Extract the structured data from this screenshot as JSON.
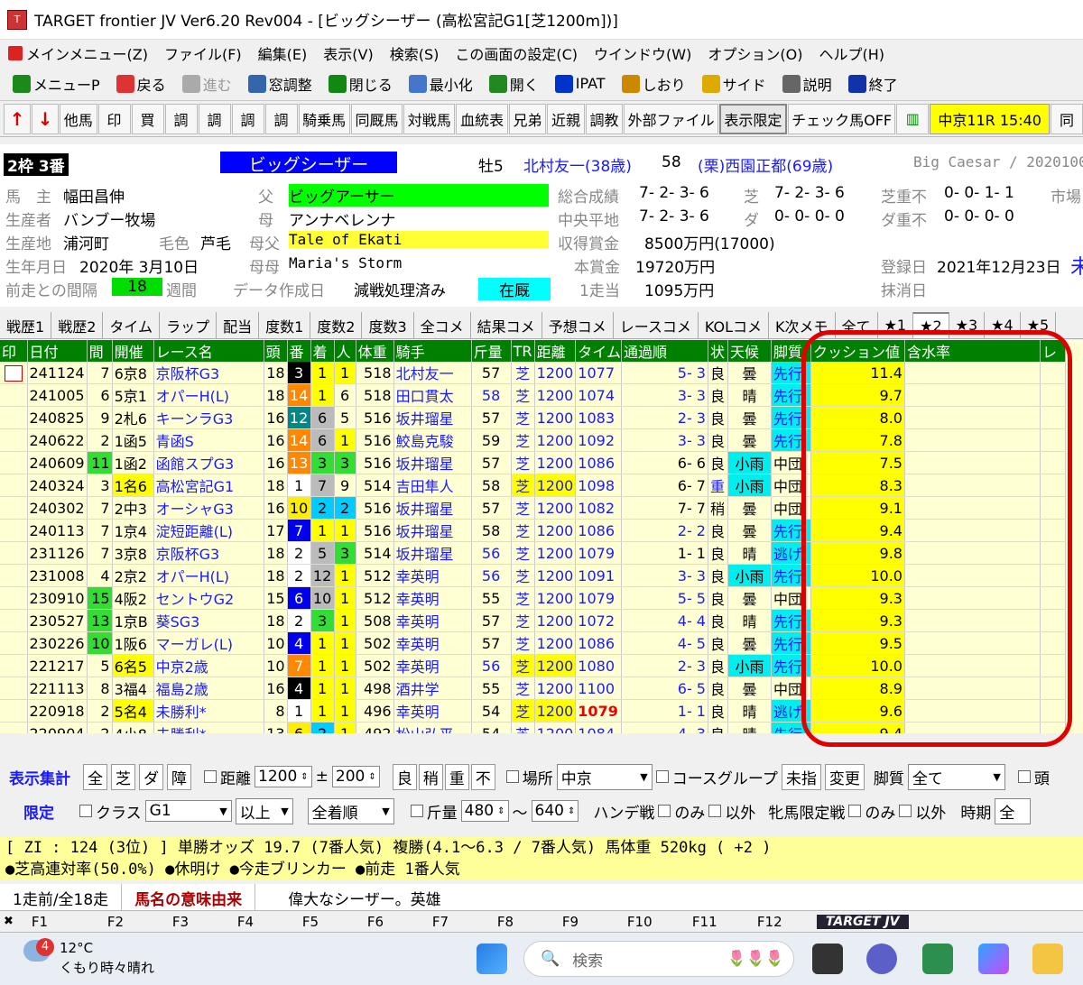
{
  "window": {
    "title": "TARGET frontier JV  Ver6.20  Rev004 - [ビッグシーザー (高松宮記G1[芝1200m])]"
  },
  "menu": [
    "メインメニュー(Z)",
    "ファイル(F)",
    "編集(E)",
    "表示(V)",
    "検索(S)",
    "この画面の設定(C)",
    "ウインドウ(W)",
    "オプション(O)",
    "ヘルプ(H)"
  ],
  "toolbar": [
    "メニューP",
    "戻る",
    "進む",
    "窓調整",
    "閉じる",
    "最小化",
    "開く",
    "IPAT",
    "しおり",
    "サイド",
    "説明",
    "終了"
  ],
  "navbar": [
    "他馬",
    "印",
    "買",
    "調",
    "調",
    "調",
    "調",
    "騎乗馬",
    "同厩馬",
    "対戦馬",
    "血統表",
    "兄弟",
    "近親",
    "調教",
    "外部ファイル",
    "表示限定",
    "チェック馬OFF",
    "同"
  ],
  "race_badge": "中京11R 15:40",
  "horse": {
    "frame": "2枠 3番",
    "name": "ビッグシーザー",
    "sex_age": "牡5",
    "jockey": "北村友一(38歳)",
    "weight": "58",
    "trainer": "(栗)西園正都(69歳)",
    "roman": "Big Caesar / 2020100",
    "owner_lbl": "馬　主",
    "owner": "幅田昌伸",
    "breeder_lbl": "生産者",
    "breeder": "バンブー牧場",
    "origin_lbl": "生産地",
    "origin": "浦河町",
    "color_lbl": "毛色",
    "color": "芦毛",
    "birth_lbl": "生年月日",
    "birth": "2020年 3月10日",
    "gap_lbl": "前走との間隔",
    "gap": "18",
    "gap_unit": "週間",
    "sire_lbl": "父",
    "sire": "ビッグアーサー",
    "dam_lbl": "母",
    "dam": "アンナベレンナ",
    "bms_lbl": "母父",
    "bms": "Tale of Ekati",
    "damdam_lbl": "母母",
    "damdam": "Maria's Storm",
    "data_lbl": "データ作成日",
    "data": "減戦処理済み",
    "status": "在厩",
    "total_lbl": "総合成績",
    "total": "7- 2- 3- 6",
    "turf_lbl": "芝",
    "turf": "7- 2- 3- 6",
    "turf_bad_lbl": "芝重不",
    "turf_bad": "0- 0- 1- 1",
    "market_lbl": "市場",
    "central_lbl": "中央平地",
    "central": "7- 2- 3- 6",
    "dirt_lbl": "ダ",
    "dirt": "0- 0- 0- 0",
    "dirt_bad_lbl": "ダ重不",
    "dirt_bad": "0- 0- 0- 0",
    "earn_lbl": "収得賞金",
    "earn": "8500万円(17000)",
    "prize_lbl": "本賞金",
    "prize": "19720万円",
    "last_lbl": "1走当",
    "last": "1095万円",
    "reg_lbl": "登録日",
    "reg": "2021年12月23日",
    "del_lbl": "抹消日",
    "side": "未"
  },
  "tabs": [
    "戦歴1",
    "戦歴2",
    "タイム",
    "ラップ",
    "配当",
    "度数1",
    "度数2",
    "度数3",
    "全コメ",
    "結果コメ",
    "予想コメ",
    "レースコメ",
    "KOLコメ",
    "K次メモ",
    "全て",
    "★1",
    "★2",
    "★3",
    "★4",
    "★5"
  ],
  "columns": [
    "印",
    "日付",
    "間",
    "開催",
    "レース名",
    "頭",
    "番",
    "着",
    "人",
    "体重",
    "騎手",
    "斤量",
    "TR",
    "距離",
    "タイム",
    "通過順",
    "状",
    "天候",
    "脚質",
    "クッション値",
    "含水率",
    "レ"
  ],
  "rows": [
    {
      "date": "241124",
      "gap": "7",
      "meet": "6京8",
      "race": "京阪杯G3",
      "n": "18",
      "no": "3",
      "pos": "1",
      "pop": "1",
      "wt": "518",
      "jk": "北村友一",
      "kg": "57",
      "tr": "芝",
      "dist": "1200",
      "time": "1077",
      "pass": "5- 3",
      "cond": "良",
      "wx": "曇",
      "style": "先行",
      "cush": "11.4"
    },
    {
      "date": "241005",
      "gap": "6",
      "meet": "5京1",
      "race": "オパーH(L)",
      "n": "18",
      "no": "14",
      "pos": "1",
      "pop": "6",
      "wt": "518",
      "jk": "田口貫太",
      "kg": "58",
      "tr": "芝",
      "dist": "1200",
      "time": "1074",
      "pass": "3- 3",
      "cond": "良",
      "wx": "晴",
      "style": "先行",
      "cush": "9.7"
    },
    {
      "date": "240825",
      "gap": "9",
      "meet": "2札6",
      "race": "キーンラG3",
      "n": "16",
      "no": "12",
      "pos": "6",
      "pop": "5",
      "wt": "516",
      "jk": "坂井瑠星",
      "kg": "57",
      "tr": "芝",
      "dist": "1200",
      "time": "1083",
      "pass": "2- 3",
      "cond": "良",
      "wx": "曇",
      "style": "先行",
      "cush": "8.0"
    },
    {
      "date": "240622",
      "gap": "2",
      "meet": "1函5",
      "race": "青函S",
      "n": "16",
      "no": "14",
      "pos": "6",
      "pop": "1",
      "wt": "516",
      "jk": "鮫島克駿",
      "kg": "59",
      "tr": "芝",
      "dist": "1200",
      "time": "1092",
      "pass": "3- 3",
      "cond": "良",
      "wx": "曇",
      "style": "先行",
      "cush": "7.8"
    },
    {
      "date": "240609",
      "gap": "11",
      "meet": "1函2",
      "race": "函館スプG3",
      "n": "16",
      "no": "13",
      "pos": "3",
      "pop": "3",
      "wt": "516",
      "jk": "坂井瑠星",
      "kg": "57",
      "tr": "芝",
      "dist": "1200",
      "time": "1086",
      "pass": "6- 6",
      "cond": "良",
      "wx": "小雨",
      "style": "中団",
      "cush": "7.5"
    },
    {
      "date": "240324",
      "gap": "3",
      "meet": "1名6",
      "race": "高松宮記G1",
      "n": "18",
      "no": "1",
      "pos": "7",
      "pop": "9",
      "wt": "514",
      "jk": "吉田隼人",
      "kg": "58",
      "tr": "芝",
      "dist": "1200",
      "time": "1098",
      "pass": "6- 7",
      "cond": "重",
      "wx": "小雨",
      "style": "中団",
      "cush": "8.3"
    },
    {
      "date": "240302",
      "gap": "7",
      "meet": "2中3",
      "race": "オーシャG3",
      "n": "16",
      "no": "10",
      "pos": "2",
      "pop": "2",
      "wt": "516",
      "jk": "坂井瑠星",
      "kg": "57",
      "tr": "芝",
      "dist": "1200",
      "time": "1082",
      "pass": "7- 7",
      "cond": "稍",
      "wx": "曇",
      "style": "中団",
      "cush": "9.1"
    },
    {
      "date": "240113",
      "gap": "7",
      "meet": "1京4",
      "race": "淀短距離(L)",
      "n": "17",
      "no": "7",
      "pos": "1",
      "pop": "1",
      "wt": "516",
      "jk": "坂井瑠星",
      "kg": "58",
      "tr": "芝",
      "dist": "1200",
      "time": "1086",
      "pass": "2- 2",
      "cond": "良",
      "wx": "曇",
      "style": "先行",
      "cush": "9.4"
    },
    {
      "date": "231126",
      "gap": "7",
      "meet": "3京8",
      "race": "京阪杯G3",
      "n": "18",
      "no": "2",
      "pos": "5",
      "pop": "3",
      "wt": "514",
      "jk": "坂井瑠星",
      "kg": "56",
      "tr": "芝",
      "dist": "1200",
      "time": "1079",
      "pass": "1- 1",
      "cond": "良",
      "wx": "晴",
      "style": "逃げ",
      "cush": "9.8"
    },
    {
      "date": "231008",
      "gap": "4",
      "meet": "2京2",
      "race": "オパーH(L)",
      "n": "18",
      "no": "2",
      "pos": "12",
      "pop": "1",
      "wt": "512",
      "jk": "幸英明",
      "kg": "56",
      "tr": "芝",
      "dist": "1200",
      "time": "1091",
      "pass": "3- 3",
      "cond": "良",
      "wx": "小雨",
      "style": "先行",
      "cush": "10.0"
    },
    {
      "date": "230910",
      "gap": "15",
      "meet": "4阪2",
      "race": "セントウG2",
      "n": "15",
      "no": "6",
      "pos": "10",
      "pop": "1",
      "wt": "512",
      "jk": "幸英明",
      "kg": "55",
      "tr": "芝",
      "dist": "1200",
      "time": "1079",
      "pass": "5- 5",
      "cond": "良",
      "wx": "曇",
      "style": "中団",
      "cush": "9.3"
    },
    {
      "date": "230527",
      "gap": "13",
      "meet": "1京B",
      "race": "葵SG3",
      "n": "18",
      "no": "2",
      "pos": "3",
      "pop": "1",
      "wt": "508",
      "jk": "幸英明",
      "kg": "57",
      "tr": "芝",
      "dist": "1200",
      "time": "1072",
      "pass": "4- 4",
      "cond": "良",
      "wx": "晴",
      "style": "先行",
      "cush": "9.3"
    },
    {
      "date": "230226",
      "gap": "10",
      "meet": "1阪6",
      "race": "マーガレ(L)",
      "n": "10",
      "no": "4",
      "pos": "1",
      "pop": "1",
      "wt": "502",
      "jk": "幸英明",
      "kg": "57",
      "tr": "芝",
      "dist": "1200",
      "time": "1086",
      "pass": "4- 5",
      "cond": "良",
      "wx": "曇",
      "style": "先行",
      "cush": "9.5"
    },
    {
      "date": "221217",
      "gap": "5",
      "meet": "6名5",
      "race": "中京2歳",
      "n": "10",
      "no": "7",
      "pos": "1",
      "pop": "1",
      "wt": "502",
      "jk": "幸英明",
      "kg": "56",
      "tr": "芝",
      "dist": "1200",
      "time": "1080",
      "pass": "2- 3",
      "cond": "良",
      "wx": "小雨",
      "style": "先行",
      "cush": "10.0"
    },
    {
      "date": "221113",
      "gap": "8",
      "meet": "3福4",
      "race": "福島2歳",
      "n": "16",
      "no": "4",
      "pos": "1",
      "pop": "1",
      "wt": "498",
      "jk": "酒井学",
      "kg": "55",
      "tr": "芝",
      "dist": "1200",
      "time": "1100",
      "pass": "6- 5",
      "cond": "良",
      "wx": "曇",
      "style": "中団",
      "cush": "8.9"
    },
    {
      "date": "220918",
      "gap": "2",
      "meet": "5名4",
      "race": "未勝利*",
      "n": "8",
      "no": "1",
      "pos": "1",
      "pop": "1",
      "wt": "496",
      "jk": "幸英明",
      "kg": "54",
      "tr": "芝",
      "dist": "1200",
      "time": "1079",
      "pass": "1- 1",
      "cond": "良",
      "wx": "晴",
      "style": "逃げ",
      "cush": "9.6"
    },
    {
      "date": "220904",
      "gap": "2",
      "meet": "4小8",
      "race": "未勝利*",
      "n": "13",
      "no": "6",
      "pos": "2",
      "pop": "1",
      "wt": "492",
      "jk": "松山弘平",
      "kg": "54",
      "tr": "芝",
      "dist": "1200",
      "time": "1084",
      "pass": "4- 3",
      "cond": "良",
      "wx": "晴",
      "style": "先行",
      "cush": "9.4"
    }
  ],
  "filter": {
    "show_lbl": "表示集計",
    "all": "全",
    "turf": "芝",
    "dirt": "ダ",
    "obs": "障",
    "dist_lbl": "距離",
    "dist_from": "1200",
    "dist_to": "200",
    "go": [
      "良",
      "稍",
      "重",
      "不"
    ],
    "place_lbl": "場所",
    "place": "中京",
    "course_lbl": "コースグループ",
    "course": "未指",
    "change": "変更",
    "style_lbl": "脚質",
    "style": "全て",
    "head_lbl": "頭",
    "limit_lbl": "限定",
    "class_lbl": "クラス",
    "class": "G1",
    "above": "以上",
    "order": "全着順",
    "kg_lbl": "斤量",
    "kg_from": "480",
    "kg_to": "640",
    "tilde": "〜",
    "handicap": "ハンデ戦",
    "only": "のみ",
    "except": "以外",
    "fillies": "牝馬限定戦",
    "only2": "のみ",
    "except2": "以外",
    "period": "時期",
    "all2": "全"
  },
  "status": {
    "line1": "[ ZI :  124 (3位)    ]  単勝オッズ  19.7 (7番人気)  複勝(4.1〜6.3 / 7番人気)  馬体重 520kg ( +2 )",
    "line2": "●芝高連対率(50.0%)  ●休明け  ●今走ブリンカー  ●前走 1番人気"
  },
  "name_tabs": [
    "1走前/全18走",
    "馬名の意味由来",
    "偉大なシーザー。英雄"
  ],
  "fkeys": [
    "F1",
    "F2",
    "F3",
    "F4",
    "F5",
    "F6",
    "F7",
    "F8",
    "F9",
    "F10",
    "F11",
    "F12"
  ],
  "fkey_logo": "TARGET JV",
  "taskbar": {
    "temp": "12°C",
    "weather": "くもり時々晴れ",
    "badge": "4",
    "search": "検索"
  }
}
